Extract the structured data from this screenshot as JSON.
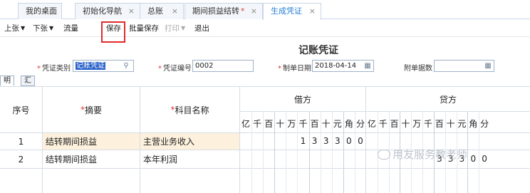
{
  "tabs": [
    {
      "label": "我的桌面",
      "closable": false,
      "modified": false,
      "active": false
    },
    {
      "label": "初始化导航",
      "closable": true,
      "modified": false,
      "active": false
    },
    {
      "label": "总账",
      "closable": true,
      "modified": false,
      "active": false
    },
    {
      "label": "期间损益结转",
      "closable": true,
      "modified": true,
      "active": false
    },
    {
      "label": "生成凭证",
      "closable": true,
      "modified": false,
      "active": true
    }
  ],
  "close_glyph": "×",
  "modified_glyph": "*",
  "toolbar": {
    "prev": "上张",
    "next": "下张",
    "flow": "流量",
    "save": "保存",
    "batch_save": "批量保存",
    "print": "打印",
    "exit": "退出"
  },
  "voucher": {
    "title": "记账凭证",
    "type_label": "凭证类别",
    "type_value": "记账凭证",
    "number_label": "凭证编号",
    "number_value": "0002",
    "date_label": "制单日期",
    "date_value": "2018-04-14",
    "attachments_label": "附单据数",
    "attachments_value": ""
  },
  "subtabs": [
    "明细",
    "汇总"
  ],
  "grid": {
    "headers": {
      "seq": "序号",
      "summary": "摘要",
      "account": "科目名称",
      "debit": "借方",
      "credit": "贷方"
    },
    "digit_units": [
      "亿",
      "千",
      "百",
      "十",
      "万",
      "千",
      "百",
      "十",
      "元",
      "角",
      "分"
    ],
    "rows": [
      {
        "seq": "1",
        "summary": "结转期间损益",
        "account": "主营业务收入",
        "debit_digits": [
          "",
          "",
          "",
          "",
          "",
          "1",
          "3",
          "3",
          "3",
          "0",
          "0"
        ],
        "credit_digits": [
          "",
          "",
          "",
          "",
          "",
          "",
          "",
          "",
          "",
          "",
          ""
        ]
      },
      {
        "seq": "2",
        "summary": "结转期间损益",
        "account": "本年利润",
        "debit_digits": [
          "",
          "",
          "",
          "",
          "",
          "",
          "",
          "",
          "",
          "",
          ""
        ],
        "credit_digits": [
          "",
          "",
          "",
          "",
          "",
          "",
          "3",
          "3",
          "3",
          "0",
          "0"
        ]
      }
    ]
  },
  "watermark": "用友服务教老师",
  "colors": {
    "accent": "#2a7fd4",
    "highlight_row": "#fdf1dd",
    "required": "#e03a3a",
    "save_outline": "#e02a2a"
  }
}
